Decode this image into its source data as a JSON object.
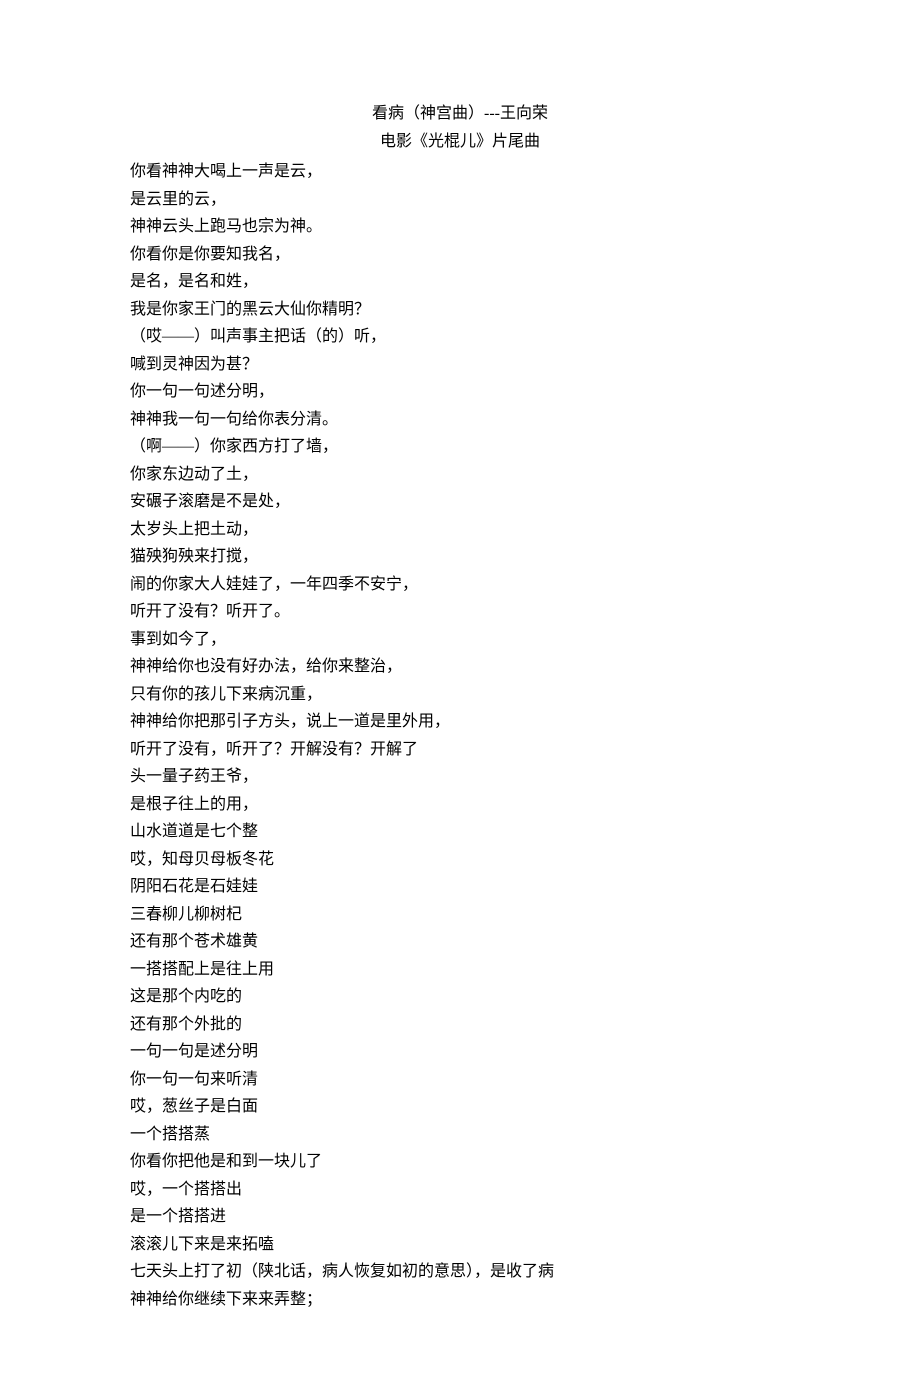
{
  "title": "看病（神宫曲）---王向荣",
  "subtitle": "电影《光棍儿》片尾曲",
  "lines": [
    "你看神神大喝上一声是云，",
    "是云里的云，",
    "神神云头上跑马也宗为神。",
    "你看你是你要知我名，",
    "是名，是名和姓，",
    "我是你家王门的黑云大仙你精明？",
    "（哎——）叫声事主把话（的）听，",
    "喊到灵神因为甚？",
    "你一句一句述分明，",
    "神神我一句一句给你表分清。",
    "（啊——）你家西方打了墙，",
    "你家东边动了土，",
    "安碾子滚磨是不是处，",
    "太岁头上把土动，",
    "猫殃狗殃来打搅，",
    "闹的你家大人娃娃了，一年四季不安宁，",
    "听开了没有？听开了。",
    "事到如今了，",
    "神神给你也没有好办法，给你来整治，",
    "只有你的孩儿下来病沉重，",
    "神神给你把那引子方头，说上一道是里外用，",
    "听开了没有，听开了？开解没有？开解了",
    "头一量子药王爷，",
    "是根子往上的用，",
    "山水道道是七个整",
    "哎，知母贝母板冬花",
    "阴阳石花是石娃娃",
    "三春柳儿柳树杞",
    "还有那个苍术雄黄",
    "一搭搭配上是往上用",
    "这是那个内吃的",
    "还有那个外批的",
    "一句一句是述分明",
    "你一句一句来听清",
    "哎，葱丝子是白面",
    "一个搭搭蒸",
    "你看你把他是和到一块儿了",
    "哎，一个搭搭出",
    "是一个搭搭进",
    "滚滚儿下来是来拓嗑",
    "七天头上打了初（陕北话，病人恢复如初的意思），是收了病",
    "神神给你继续下来来弄整；"
  ]
}
